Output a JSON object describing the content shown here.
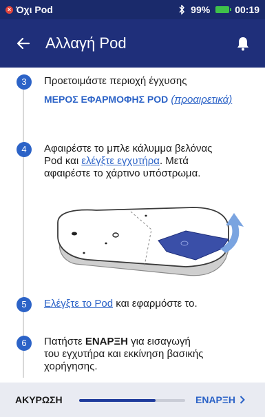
{
  "status_bar": {
    "pod_status": "Όχι Pod",
    "battery_percent": "99%",
    "time": "00:19",
    "icons": [
      "error-x-icon",
      "bluetooth-icon",
      "battery-icon"
    ]
  },
  "app_bar": {
    "title": "Αλλαγή Pod",
    "icons": [
      "back-arrow-icon",
      "bell-icon"
    ]
  },
  "steps": [
    {
      "number": "3",
      "text": "Προετοιμάστε περιοχή έγχυσης",
      "link_caps": "ΜΕΡΟΣ ΕΦΑΡΜΟΦΗΣ POD",
      "link_optional": "(προαιρετικά)"
    },
    {
      "number": "4",
      "text_1": "Αφαιρέστε το μπλε κάλυμμα βελόνας",
      "text_2a": "Pod και ",
      "link": "ελέγξτε εγχυτήρα",
      "text_2b": ". Μετά",
      "text_3": "αφαιρέστε το χάρτινο υπόστρωμα."
    },
    {
      "number": "5",
      "link": "Ελέγξτε το Pod",
      "text": " και εφαρμόστε το."
    },
    {
      "number": "6",
      "text_1a": "Πατήστε ",
      "text_1_bold": "ΕΝΑΡΞΗ",
      "text_1b": " για εισαγωγή",
      "text_2": "του εγχυτήρα και εκκίνηση βασικής",
      "text_3": "χορήγησης."
    }
  ],
  "bottom_bar": {
    "cancel_label": "ΑΚΥΡΩΣΗ",
    "start_label": "ΕΝΑΡΞΗ",
    "progress_fraction": 0.72
  },
  "colors": {
    "status_bar": "#1a2a6b",
    "app_bar": "#1f2f7a",
    "accent": "#2c63c7",
    "bottom_bar": "#e9ebf2"
  }
}
